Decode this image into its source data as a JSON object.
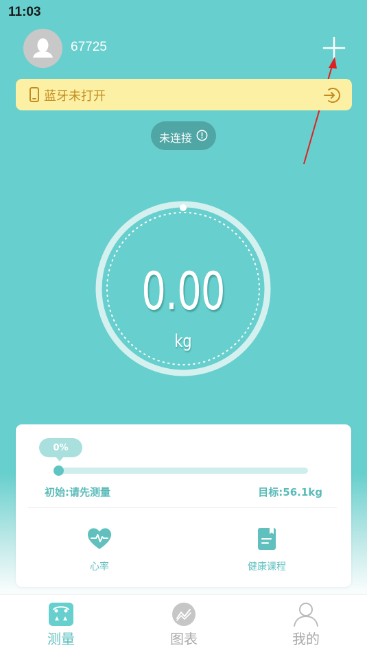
{
  "status_bar": {
    "time": "11:03"
  },
  "header": {
    "username": "67725",
    "avatar_icon": "user-avatar-icon",
    "add_icon": "plus-icon"
  },
  "bluetooth_banner": {
    "text": "蓝牙未打开",
    "text_color": "#c58a1f",
    "background": "#fbf0a4"
  },
  "connection": {
    "status": "未连接"
  },
  "weight": {
    "value": "0.00",
    "unit": "kg"
  },
  "progress_card": {
    "percent": "0%",
    "progress_fraction": 0,
    "start_label": "初始:请先测量",
    "target_label": "目标:56.1kg",
    "features": [
      {
        "label": "心率",
        "icon": "heart-rate-icon"
      },
      {
        "label": "健康课程",
        "icon": "course-book-icon"
      }
    ]
  },
  "tabbar": {
    "tabs": [
      {
        "label": "测量",
        "icon": "scale-icon",
        "active": true
      },
      {
        "label": "图表",
        "icon": "chart-icon",
        "active": false
      },
      {
        "label": "我的",
        "icon": "profile-icon",
        "active": false
      }
    ]
  },
  "colors": {
    "accent": "#67cfcd",
    "annotation_arrow": "#e02020"
  }
}
